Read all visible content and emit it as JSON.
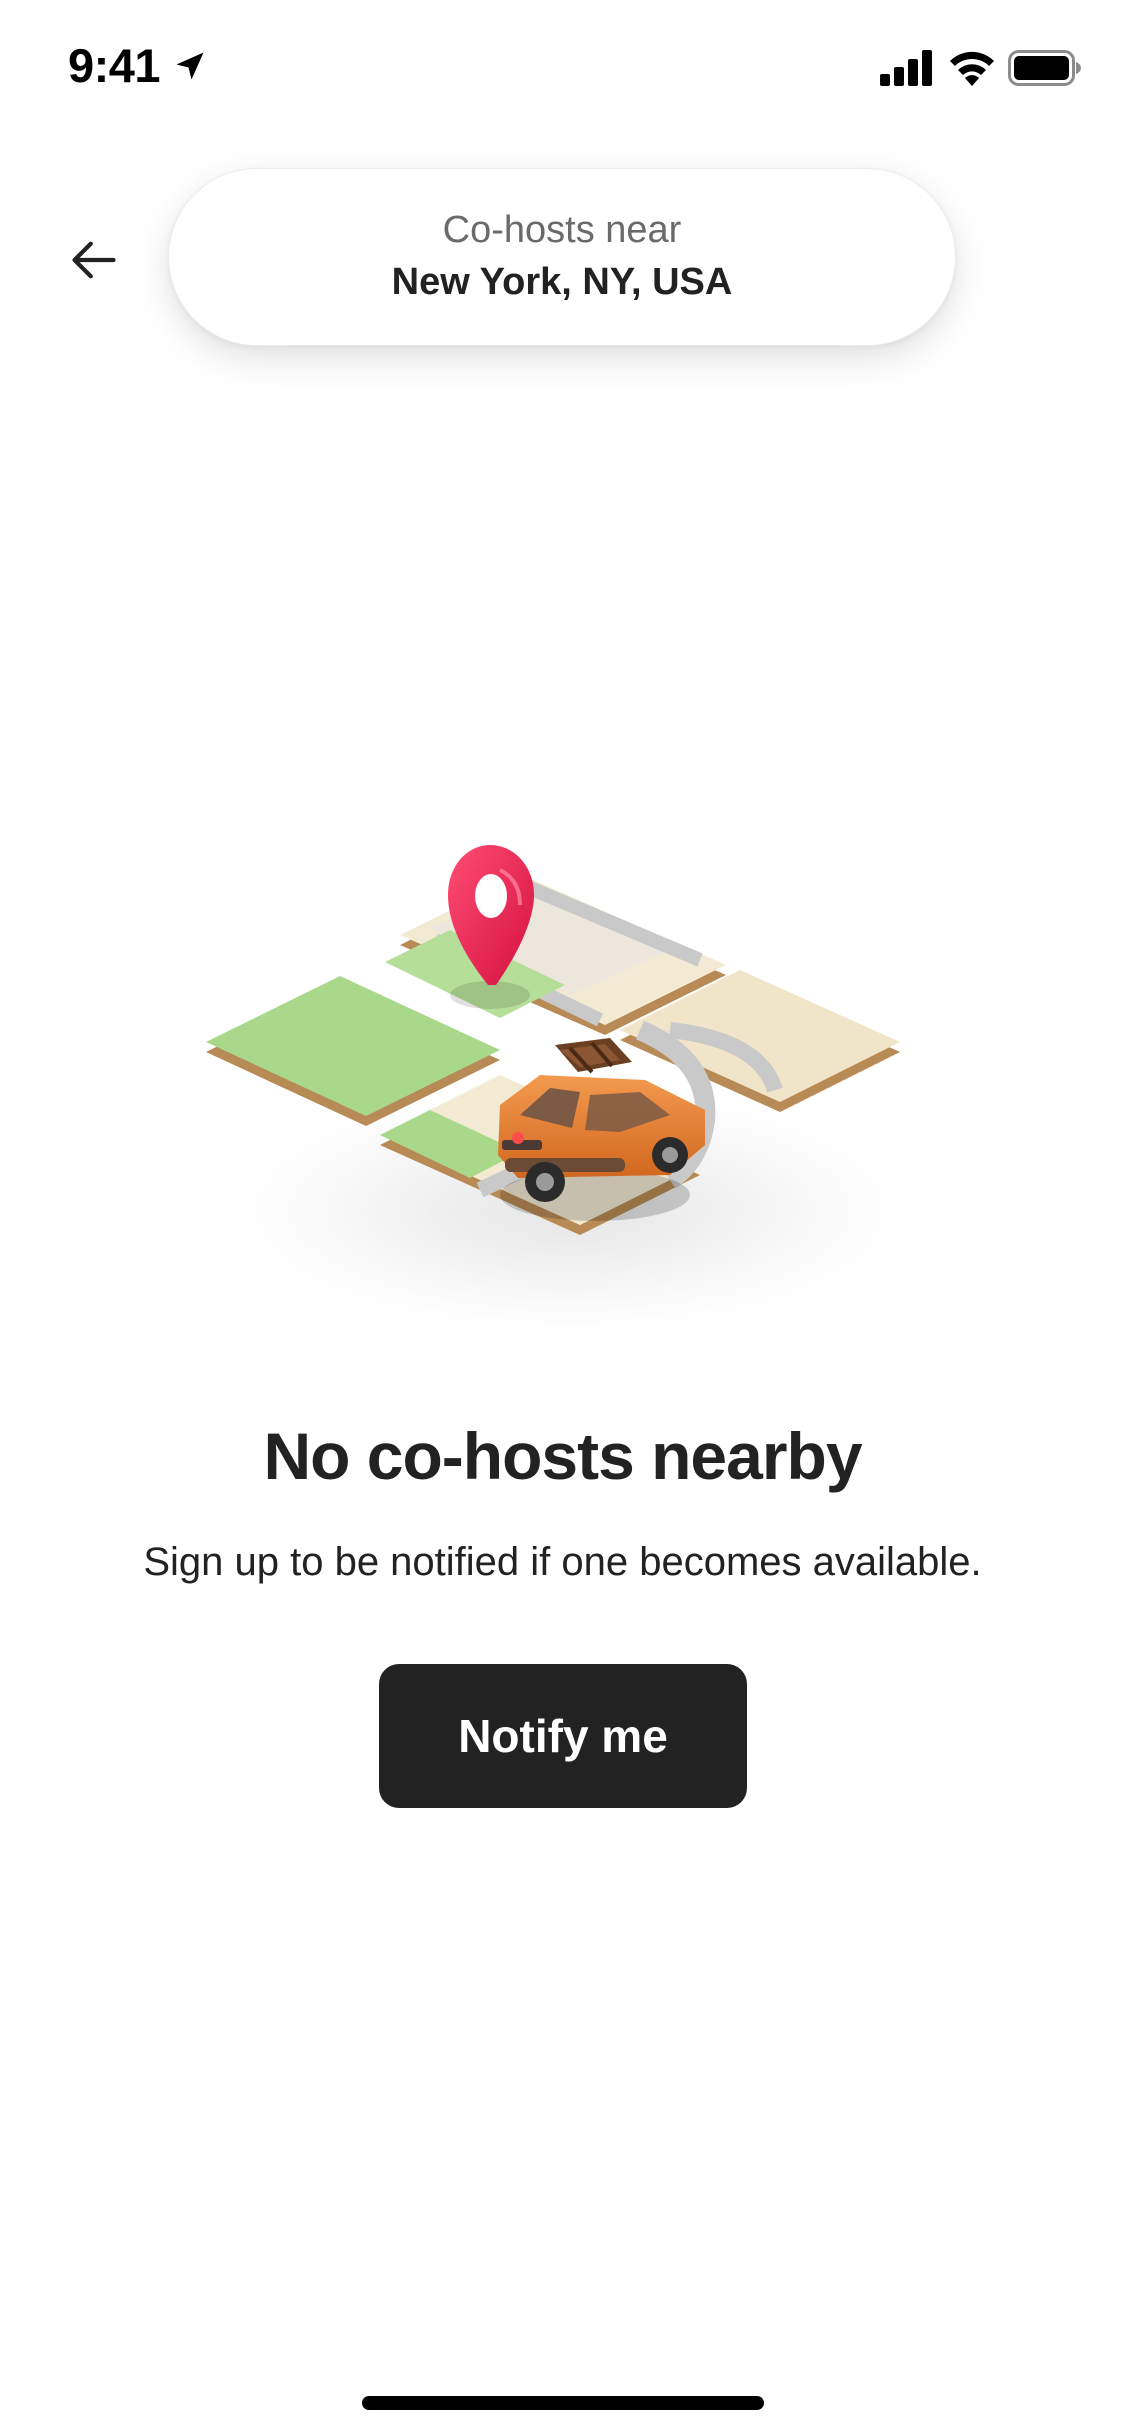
{
  "status_bar": {
    "time": "9:41",
    "icons": [
      "location-arrow-icon",
      "cellular-signal-icon",
      "wifi-icon",
      "battery-icon"
    ]
  },
  "header": {
    "back_icon": "back-arrow-icon",
    "search_label": "Co-hosts near",
    "search_location": "New York, NY, USA"
  },
  "empty_state": {
    "illustration": "map-tiles-with-pin-and-car",
    "title": "No co-hosts nearby",
    "subtitle": "Sign up to be notified if one becomes available.",
    "button_label": "Notify me"
  },
  "colors": {
    "text_primary": "#222222",
    "text_secondary": "#6a6a6a",
    "button_bg": "#222222",
    "pin": "#e8194f",
    "car": "#e07a2c",
    "park": "#a8d889",
    "tile": "#efe6cd"
  }
}
